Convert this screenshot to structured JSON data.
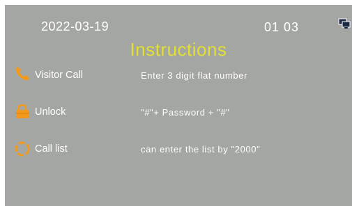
{
  "status_bar": {
    "date": "2022-03-19",
    "time": "01 03",
    "network_icon": "monitor-network-icon"
  },
  "title": "Instructions",
  "rows": [
    {
      "icon": "phone-handset-icon",
      "label": "Visitor Call",
      "description": "Enter 3 digit flat number"
    },
    {
      "icon": "padlock-icon",
      "label": "Unlock",
      "description": "\"#\"+ Password + \"#\""
    },
    {
      "icon": "dotted-ring-icon",
      "label": "Call list",
      "description": "can enter the list by \"2000\""
    }
  ],
  "colors": {
    "background": "#a4a6a3",
    "title": "#e2e032",
    "text": "#ffffff",
    "icon_orange": "#f39a1c"
  }
}
